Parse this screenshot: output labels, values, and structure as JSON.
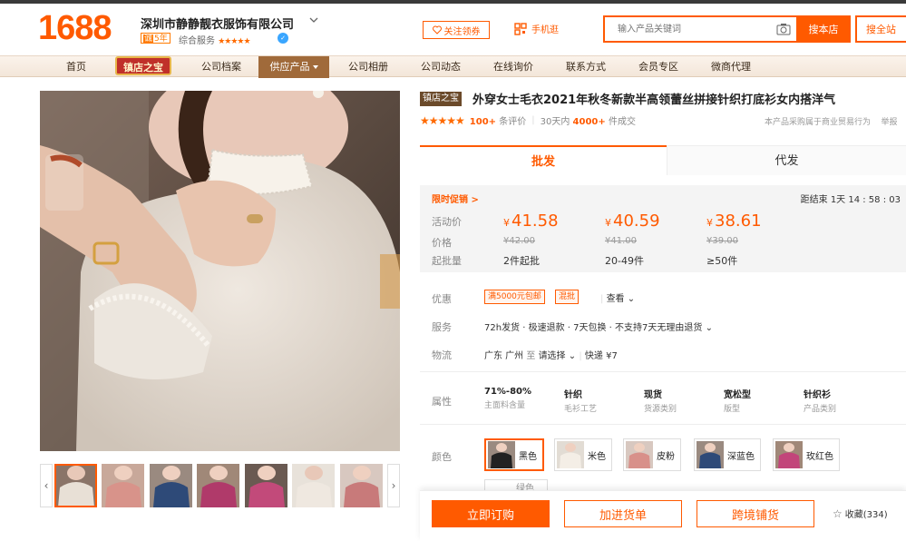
{
  "header": {
    "logo": "1688",
    "company": "深圳市静静靓衣服饰有限公司",
    "year_badge_prefix": "诚",
    "year_badge": "5年",
    "service_label": "综合服务",
    "service_stars": "★★★★★",
    "follow": "关注领券",
    "mobile": "手机逛",
    "search_placeholder": "输入产品关键词",
    "search_store": "搜本店",
    "search_all": "搜全站"
  },
  "nav": {
    "items": [
      "首页",
      "公司档案",
      "供应产品",
      "公司相册",
      "公司动态",
      "在线询价",
      "联系方式",
      "会员专区",
      "微商代理"
    ],
    "badge": "镇店之宝"
  },
  "product": {
    "title_badge": "镇店之宝",
    "title": "外穿女士毛衣2021年秋冬新款半高领蕾丝拼接针织打底衫女内搭洋气",
    "stars": "★★★★★",
    "reviews_count": "100+",
    "reviews_label": "条评价",
    "sales_prefix": "30天内",
    "sales_count": "4000+",
    "sales_suffix": "件成交",
    "note": "本产品采购属于商业贸易行为",
    "note_more": "举报"
  },
  "tabs": {
    "wholesale": "批发",
    "dropship": "代发"
  },
  "pricing": {
    "promo": "限时促销 >",
    "countdown": "距结束 1天 14 : 58 : 03",
    "labels": {
      "promo_price": "活动价",
      "price": "价格",
      "moq": "起批量"
    },
    "tiers": [
      {
        "currency": "¥",
        "price": "41.58",
        "orig": "¥42.00",
        "qty": "2件起批"
      },
      {
        "currency": "¥",
        "price": "40.59",
        "orig": "¥41.00",
        "qty": "20-49件"
      },
      {
        "currency": "¥",
        "price": "38.61",
        "orig": "¥39.00",
        "qty": "≥50件"
      }
    ]
  },
  "offer": {
    "label": "优惠",
    "coupon1": "满5000元包邮",
    "coupon2": "混批",
    "more": "查看"
  },
  "service": {
    "label": "服务",
    "text": "72h发货 · 极速退款 · 7天包换 · 不支持7天无理由退货"
  },
  "shipping": {
    "label": "物流",
    "from": "广东 广州",
    "to_label": "至",
    "select": "请选择",
    "express": "快递",
    "fee": "¥7"
  },
  "attributes": {
    "label": "属性",
    "items": [
      {
        "value": "71%-80%",
        "key": "主面料含量"
      },
      {
        "value": "针织",
        "key": "毛衫工艺"
      },
      {
        "value": "现货",
        "key": "货源类别"
      },
      {
        "value": "宽松型",
        "key": "版型"
      },
      {
        "value": "针织衫",
        "key": "产品类别"
      }
    ]
  },
  "colors": {
    "label": "颜色",
    "options": [
      "黑色",
      "米色",
      "皮粉",
      "深蓝色",
      "玫红色"
    ],
    "partial": "绿色"
  },
  "actions": {
    "order": "立即订购",
    "cart": "加进货单",
    "cross": "跨境铺货",
    "fav": "收藏(334)"
  },
  "accent": "#ff5a00"
}
